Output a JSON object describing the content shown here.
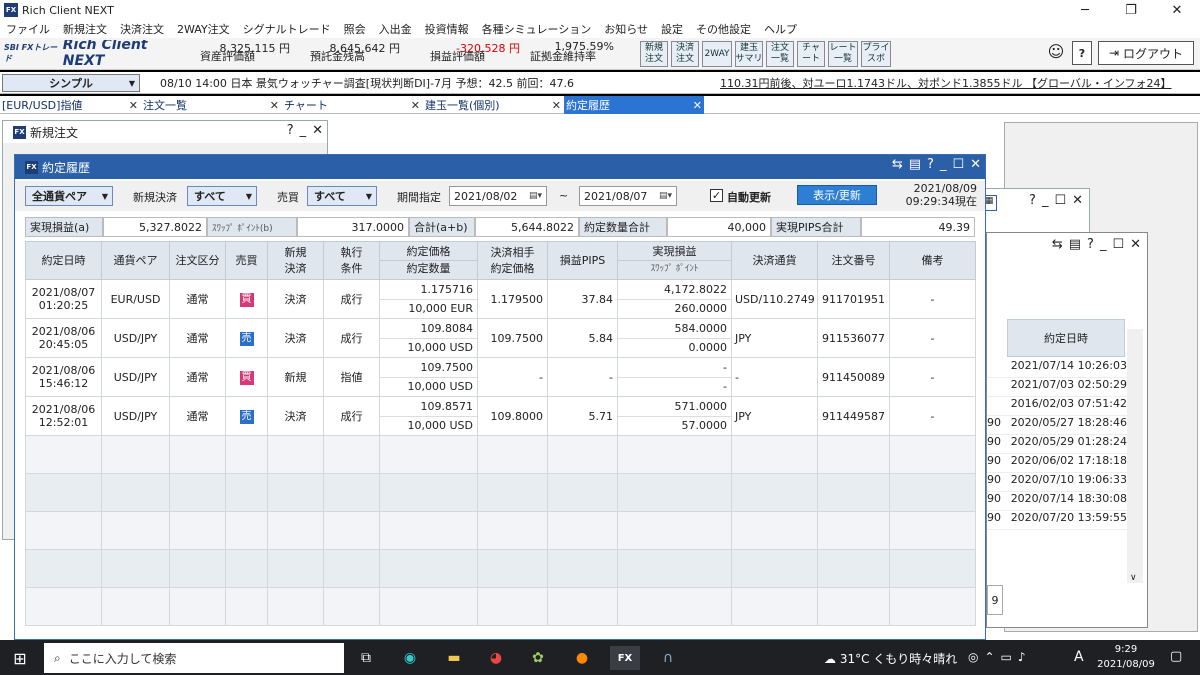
{
  "app": {
    "title": "Rich Client NEXT",
    "logo": "FX"
  },
  "menu": [
    "ファイル",
    "新規注文",
    "決済注文",
    "2WAY注文",
    "シグナルトレード",
    "照会",
    "入出金",
    "投資情報",
    "各種シミュレーション",
    "お知らせ",
    "設定",
    "その他設定",
    "ヘルプ"
  ],
  "brand": {
    "text": "Rich Client NEXT",
    "prefix": "SBI FXトレード"
  },
  "stats": [
    {
      "label": "資産評価額",
      "value": "8,325,115 円"
    },
    {
      "label": "預託金残高",
      "value": "8,645,642 円"
    },
    {
      "label": "損益評価額",
      "value": "-320,528 円"
    },
    {
      "label": "証拠金維持率",
      "value": "1,975.59%"
    }
  ],
  "toolbar_buttons": [
    "新規\n注文",
    "決済\n注文",
    "2WAY",
    "建玉\nサマリ",
    "注文\n一覧",
    "チャ\nート",
    "レート\n一覧",
    "プライ\nスボ"
  ],
  "logout": "ログアウト",
  "help": "?",
  "view_mode": "シンプル",
  "ticker": "08/10 14:00 日本 景気ウォッチャー調査[現状判断DI]-7月 予想：42.5 前回：47.6",
  "ticker2": "110.31円前後、対ユーロ1.1743ドル、対ポンド1.3855ドル 【グローバル・インフォ24】",
  "tabs": [
    {
      "label": "[EUR/USD]指値"
    },
    {
      "label": "注文一覧"
    },
    {
      "label": "チャート"
    },
    {
      "label": "建玉一覧(個別)"
    },
    {
      "label": "約定履歴"
    }
  ],
  "tab_close": "✕",
  "win_new_order": {
    "title": "新規注文"
  },
  "main": {
    "title": "約定履歴",
    "pair_sel": "全通貨ペア",
    "new_close_label": "新規決済",
    "new_close_sel": "すべて",
    "side_label": "売買",
    "side_sel": "すべて",
    "period_label": "期間指定",
    "date_from": "2021/08/02",
    "tilde": "~",
    "date_to": "2021/08/07",
    "auto_label": "自動更新",
    "auto_checked": "✓",
    "refresh": "表示/更新",
    "asof_date": "2021/08/09",
    "asof_time": "09:29:34現在",
    "summary": {
      "realized_label": "実現損益(a)",
      "realized": "5,327.8022",
      "swap_label": "ｽﾜｯﾌﾟ ﾎﾟｲﾝﾄ(b)",
      "swap": "317.0000",
      "total_label": "合計(a+b)",
      "total": "5,644.8022",
      "qty_label": "約定数量合計",
      "qty": "40,000",
      "pips_label": "実現PIPS合計",
      "pips": "49.39"
    },
    "headers": {
      "date": "約定日時",
      "pair": "通貨ペア",
      "type": "注文区分",
      "side": "売買",
      "nc1": "新規",
      "nc2": "決済",
      "cond1": "執行",
      "cond2": "条件",
      "price1": "約定価格",
      "price2": "約定数量",
      "cp1": "決済相手",
      "cp2": "約定価格",
      "pips": "損益PIPS",
      "pl1": "実現損益",
      "pl2": "ｽﾜｯﾌﾟ ﾎﾟｲﾝﾄ",
      "ccy": "決済通貨",
      "no": "注文番号",
      "note": "備考"
    },
    "rows": [
      {
        "d1": "2021/08/07",
        "d2": "01:20:25",
        "pair": "EUR/USD",
        "type": "通常",
        "side": "買",
        "side_type": "buy",
        "nc": "決済",
        "cond": "成行",
        "price": "1.175716",
        "qty": "10,000 EUR",
        "cp": "1.179500",
        "pips": "37.84",
        "pl": "4,172.8022",
        "swap": "260.0000",
        "ccy": "USD/110.2749",
        "no": "911701951",
        "note": "-"
      },
      {
        "d1": "2021/08/06",
        "d2": "20:45:05",
        "pair": "USD/JPY",
        "type": "通常",
        "side": "売",
        "side_type": "sell",
        "nc": "決済",
        "cond": "成行",
        "price": "109.8084",
        "qty": "10,000 USD",
        "cp": "109.7500",
        "pips": "5.84",
        "pl": "584.0000",
        "swap": "0.0000",
        "ccy": "JPY",
        "no": "911536077",
        "note": "-"
      },
      {
        "d1": "2021/08/06",
        "d2": "15:46:12",
        "pair": "USD/JPY",
        "type": "通常",
        "side": "買",
        "side_type": "buy",
        "nc": "新規",
        "cond": "指値",
        "price": "109.7500",
        "qty": "10,000 USD",
        "cp": "-",
        "pips": "-",
        "pl": "-",
        "swap": "-",
        "ccy": "-",
        "no": "911450089",
        "note": "-"
      },
      {
        "d1": "2021/08/06",
        "d2": "12:52:01",
        "pair": "USD/JPY",
        "type": "通常",
        "side": "売",
        "side_type": "sell",
        "nc": "決済",
        "cond": "成行",
        "price": "109.8571",
        "qty": "10,000 USD",
        "cp": "109.8000",
        "pips": "5.71",
        "pl": "571.0000",
        "swap": "57.0000",
        "ccy": "JPY",
        "no": "911449587",
        "note": "-"
      }
    ]
  },
  "right": {
    "header": "約定日時",
    "rows": [
      {
        "a": "",
        "b": "2021/07/14 10:26:03"
      },
      {
        "a": "",
        "b": "2021/07/03 02:50:29"
      },
      {
        "a": "",
        "b": "2016/02/03 07:51:42"
      },
      {
        "a": "90",
        "b": "2020/05/27 18:28:46"
      },
      {
        "a": "90",
        "b": "2020/05/29 01:28:24"
      },
      {
        "a": "90",
        "b": "2020/06/02 17:18:18"
      },
      {
        "a": "90",
        "b": "2020/07/10 19:06:33"
      },
      {
        "a": "90",
        "b": "2020/07/14 18:30:08"
      },
      {
        "a": "90",
        "b": "2020/07/20 13:59:55"
      }
    ],
    "footer": "9"
  },
  "taskbar": {
    "search": "ここに入力して検索",
    "weather": "31°C くもり時々晴れ",
    "ime": "A",
    "time": "9:29",
    "date": "2021/08/09",
    "fx": "FX"
  }
}
